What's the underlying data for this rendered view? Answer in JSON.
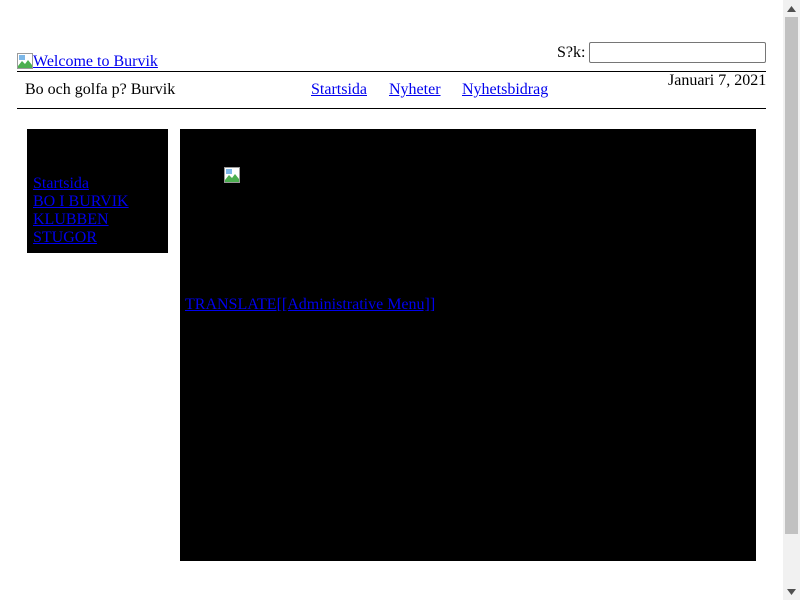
{
  "header": {
    "logo_alt": "Welcome to Burvik",
    "search_label": "S?k:",
    "search_value": "",
    "tagline": "Bo och golfa p? Burvik",
    "date": "Januari 7, 2021",
    "nav": [
      "Startsida",
      "Nyheter",
      "Nyhetsbidrag"
    ]
  },
  "sidebar": {
    "items": [
      "Startsida",
      "BO I BURVIK",
      "KLUBBEN",
      "STUGOR"
    ]
  },
  "main": {
    "translate": "TRANSLATE",
    "admin_menu": "[[Administrative Menu]]"
  },
  "colors": {
    "link": "#0000ee",
    "panel_bg": "#000000",
    "page_bg": "#ffffff",
    "scrollbar_track": "#f1f1f1",
    "scrollbar_thumb": "#c1c1c1"
  },
  "icons": {
    "broken_image": "broken-image-icon",
    "scroll_up": "arrow-up-icon",
    "scroll_down": "arrow-down-icon"
  }
}
